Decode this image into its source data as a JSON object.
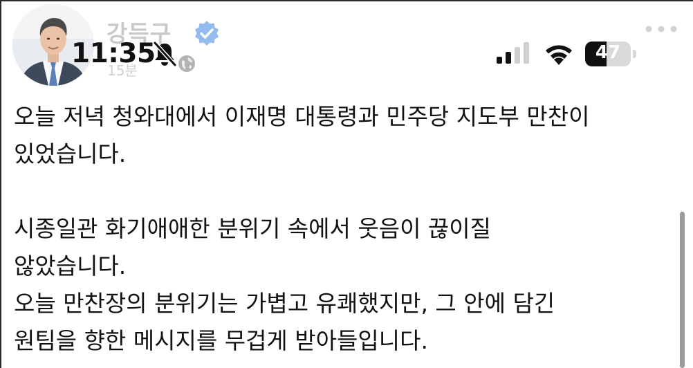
{
  "post": {
    "author": "강득구",
    "time": "15분",
    "lines": [
      "오늘 저녁 청와대에서 이재명 대통령과 민주당 지도부 만찬이",
      "있었습니다.",
      "",
      "시종일관 화기애애한 분위기 속에서 웃음이 끊이질",
      "않았습니다.",
      "오늘 만찬장의 분위기는 가볍고 유쾌했지만, 그 안에 담긴",
      "원팀을 향한 메시지를 무겁게 받아들입니다."
    ]
  },
  "status_bar": {
    "time": "11:35",
    "battery_level": "47",
    "battery_fraction": 0.47
  },
  "icons": {
    "verified": "verified-badge-icon",
    "globe": "globe-icon",
    "more": "more-options-icon",
    "silent": "bell-slash-icon",
    "signal": "cellular-signal-icon",
    "wifi": "wifi-icon",
    "battery": "battery-icon"
  },
  "colors": {
    "verified_blue": "#4a90e2",
    "text": "#111111",
    "faded_header": "#c9c9c9"
  }
}
